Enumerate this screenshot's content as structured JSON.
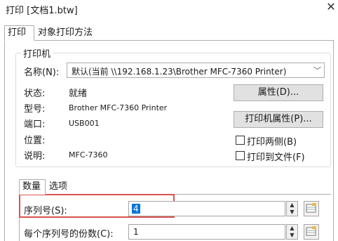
{
  "window": {
    "title": "打印 [文档1.btw]",
    "close_glyph": "✕"
  },
  "tabs": [
    {
      "label": "打印",
      "active": true
    },
    {
      "label": "对象打印方法",
      "active": false
    }
  ],
  "printer_group": {
    "title": "打印机",
    "name_label": "名称(N):",
    "name_value": "默认(当前 \\\\192.168.1.23\\Brother MFC-7360 Printer)",
    "status_label": "状态:",
    "status_value": "就绪",
    "model_label": "型号:",
    "model_value": "Brother MFC-7360 Printer",
    "port_label": "端口:",
    "port_value": "USB001",
    "location_label": "位置:",
    "location_value": "",
    "comment_label": "说明:",
    "comment_value": "MFC-7360",
    "properties_button": "属性(D)...",
    "printer_properties_button": "打印机属性(P)...",
    "duplex_label": "打印两侧(B)",
    "print_to_file_label": "打印到文件(F)",
    "duplex_checked": false,
    "print_to_file_checked": false
  },
  "subtabs": [
    {
      "label": "数量",
      "active": true
    },
    {
      "label": "选项",
      "active": false
    }
  ],
  "quantity": {
    "serial_label": "序列号(S):",
    "serial_value": "4",
    "copies_label": "每个序列号的份数(C):",
    "copies_value": "1"
  },
  "colors": {
    "highlight": "#d9534f",
    "selection": "#0078d7"
  }
}
